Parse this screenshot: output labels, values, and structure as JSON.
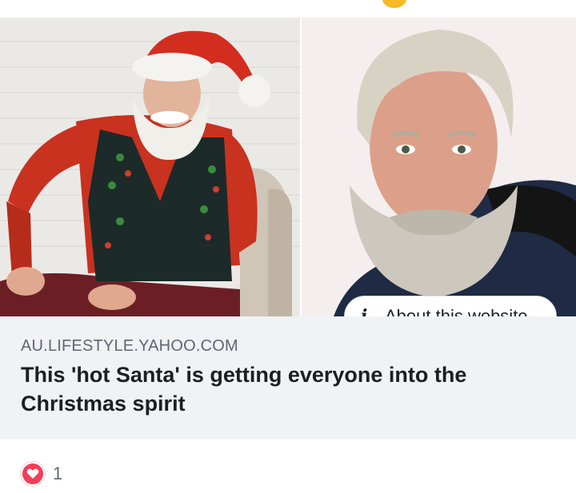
{
  "link_preview": {
    "about_label": "About this website",
    "domain": "AU.LIFESTYLE.YAHOO.COM",
    "headline": "This 'hot Santa' is getting everyone into the Christmas spirit",
    "images": [
      {
        "name": "santa-costume-photo"
      },
      {
        "name": "bearded-man-portrait"
      }
    ]
  },
  "reactions": {
    "icon": "love-reaction-icon",
    "count": "1",
    "color": "#f33e58"
  },
  "colors": {
    "meta_background": "#f0f2f5",
    "headline_text": "#1c1e21",
    "domain_text": "#606770"
  }
}
